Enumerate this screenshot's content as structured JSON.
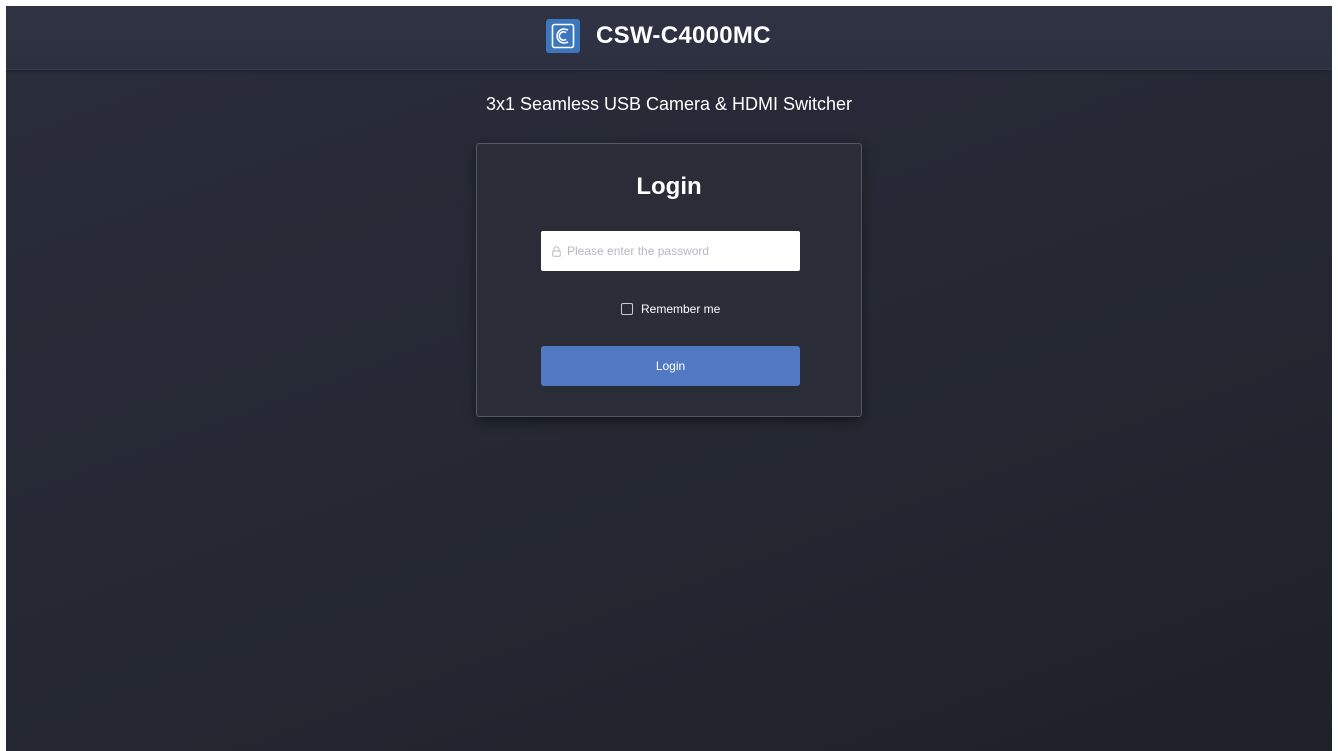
{
  "header": {
    "brand_title": "CSW-C4000MC",
    "logo_icon": "c-logo-icon",
    "logo_color": "#3c77bd"
  },
  "subtitle": "3x1 Seamless USB Camera & HDMI Switcher",
  "login": {
    "title": "Login",
    "password_placeholder": "Please enter the password",
    "password_value": "",
    "password_icon": "lock-icon",
    "remember_label": "Remember me",
    "remember_checked": false,
    "button_label": "Login",
    "button_color": "#5079c2"
  }
}
